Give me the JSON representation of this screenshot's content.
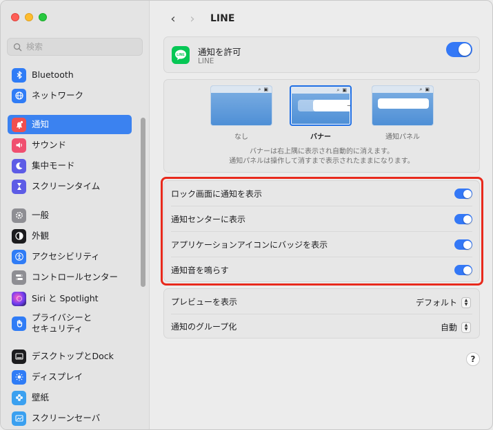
{
  "sidebar": {
    "search_placeholder": "検索",
    "items": [
      {
        "label": "Bluetooth",
        "icon": "bluetooth-icon",
        "color": "#2f7cf6"
      },
      {
        "label": "ネットワーク",
        "icon": "globe-icon",
        "color": "#2f7cf6"
      },
      {
        "label": "通知",
        "icon": "bell-icon",
        "color": "#f04f4f",
        "selected": true
      },
      {
        "label": "サウンド",
        "icon": "speaker-icon",
        "color": "#f04f6f"
      },
      {
        "label": "集中モード",
        "icon": "moon-icon",
        "color": "#5d5ce6"
      },
      {
        "label": "スクリーンタイム",
        "icon": "hourglass-icon",
        "color": "#5d5ce6"
      },
      {
        "label": "一般",
        "icon": "gear-icon",
        "color": "#8e8e93"
      },
      {
        "label": "外観",
        "icon": "appearance-icon",
        "color": "#1c1c1e"
      },
      {
        "label": "アクセシビリティ",
        "icon": "accessibility-icon",
        "color": "#2f7cf6"
      },
      {
        "label": "コントロールセンター",
        "icon": "control-center-icon",
        "color": "#8e8e93"
      },
      {
        "label": "Siri と Spotlight",
        "icon": "siri-icon",
        "color": "#7a3cf0"
      },
      {
        "label_line1": "プライバシーと",
        "label_line2": "セキュリティ",
        "icon": "hand-icon",
        "color": "#2f7cf6"
      },
      {
        "label": "デスクトップとDock",
        "icon": "dock-icon",
        "color": "#1c1c1e"
      },
      {
        "label": "ディスプレイ",
        "icon": "sun-icon",
        "color": "#2f7cf6"
      },
      {
        "label": "壁紙",
        "icon": "flower-icon",
        "color": "#3aa0f0"
      },
      {
        "label": "スクリーンセーバ",
        "icon": "screensaver-icon",
        "color": "#3aa0f0"
      }
    ]
  },
  "header": {
    "back": "‹",
    "forward": "›",
    "title": "LINE"
  },
  "app": {
    "allow_title": "通知を許可",
    "app_name": "LINE",
    "allow_enabled": true
  },
  "styles": {
    "options": [
      {
        "label": "なし",
        "selected": false
      },
      {
        "label": "バナー",
        "selected": true
      },
      {
        "label": "通知パネル",
        "selected": false
      }
    ],
    "desc_line1": "バナーは右上隅に表示され自動的に消えます。",
    "desc_line2": "通知パネルは操作して消すまで表示されたままになります。"
  },
  "toggles": [
    {
      "label": "ロック画面に通知を表示",
      "enabled": true
    },
    {
      "label": "通知センターに表示",
      "enabled": true
    },
    {
      "label": "アプリケーションアイコンにバッジを表示",
      "enabled": true
    },
    {
      "label": "通知音を鳴らす",
      "enabled": true
    }
  ],
  "preview": {
    "label": "プレビューを表示",
    "value": "デフォルト"
  },
  "grouping": {
    "label": "通知のグループ化",
    "value": "自動"
  },
  "help": "?",
  "colors": {
    "accent": "#3478f6",
    "highlight": "#e8291c",
    "line_green": "#06c755"
  }
}
